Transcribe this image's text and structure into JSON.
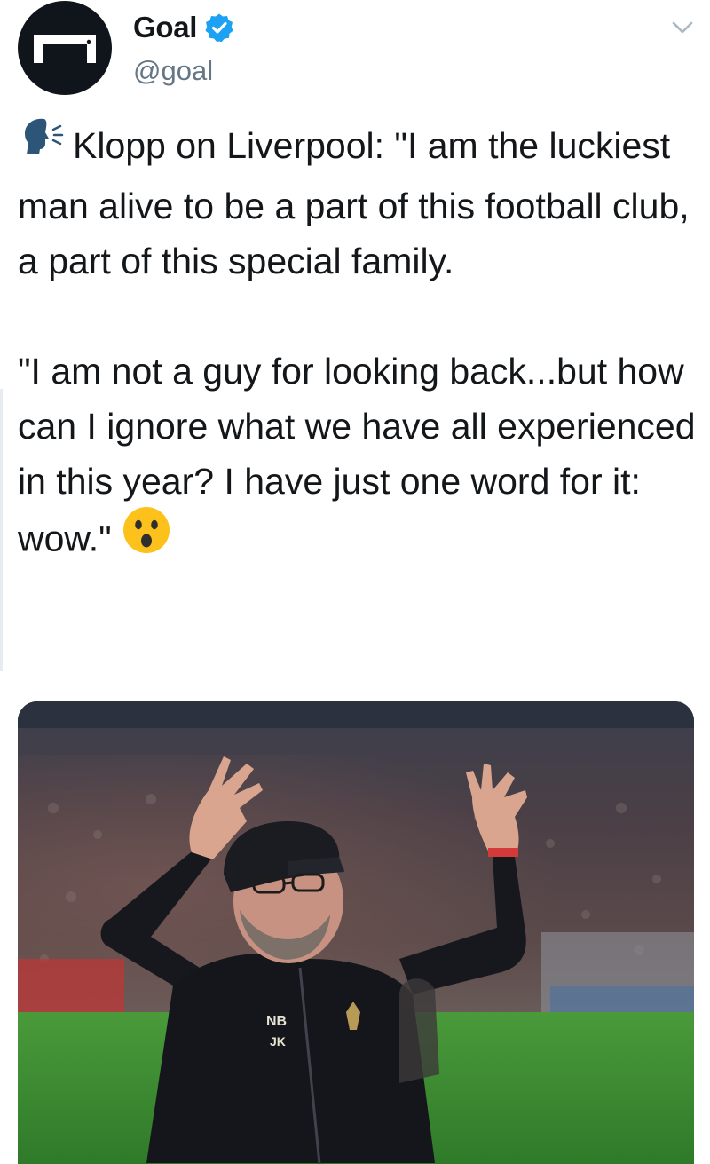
{
  "header": {
    "display_name": "Goal",
    "handle": "@goal",
    "verified": true,
    "avatar_icon": "goal-logo-icon",
    "menu_icon": "chevron-down-icon"
  },
  "tweet": {
    "emoji_lead": "speaking-head-emoji",
    "paragraph_1": "Klopp on Liverpool: \"I am the luckiest man alive to be a part of this football club, a part of this special family.",
    "paragraph_2": "\"I am not a guy for looking back...but how can I ignore what we have all experienced in this year? I have just one word for it: wow.\"",
    "emoji_trail": "astonished-face-emoji"
  },
  "media": {
    "photo_icon": "photo-klopp-celebrating",
    "jacket_logo": "NB",
    "jacket_initials": "JK"
  },
  "colors": {
    "text": "#14171a",
    "secondary": "#657786",
    "verified_blue": "#1da1f2",
    "avatar_bg": "#10151b"
  }
}
